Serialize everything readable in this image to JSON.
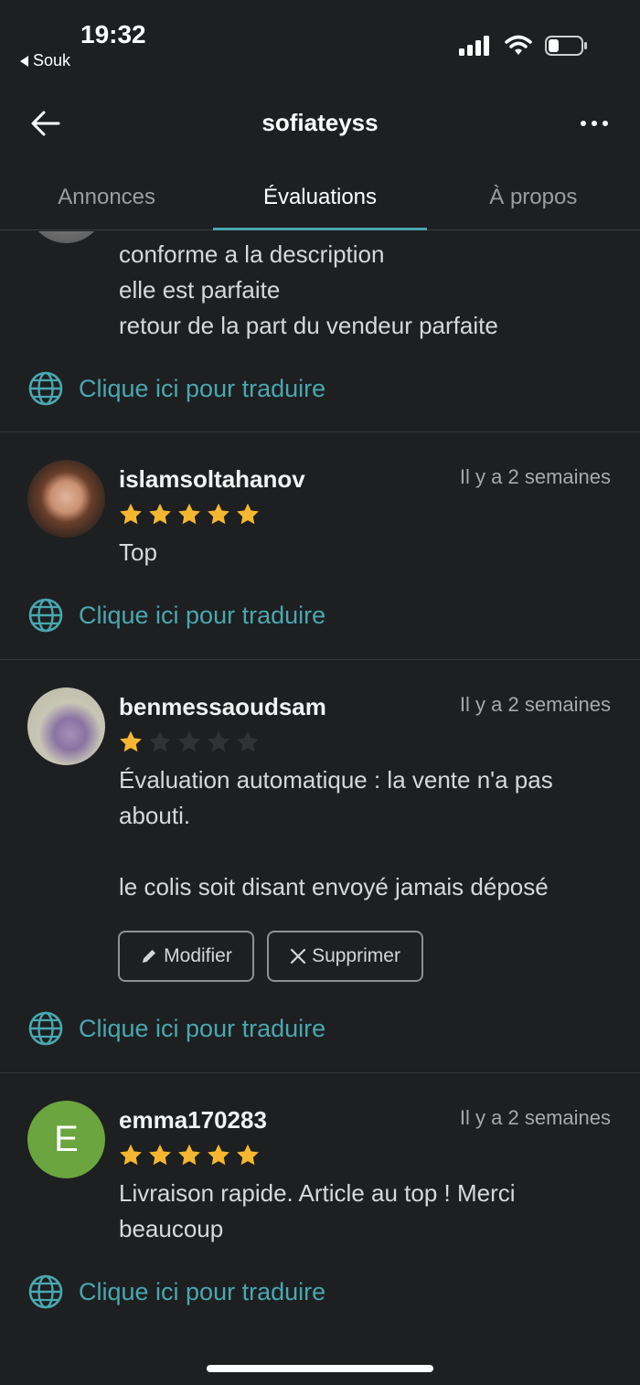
{
  "status_bar": {
    "time": "19:32",
    "back_app": "Souk",
    "icons": [
      "signal-icon",
      "wifi-icon",
      "battery-icon"
    ]
  },
  "header": {
    "title": "sofiateyss",
    "back_icon": "arrow-left-icon",
    "more_icon": "more-horizontal-icon"
  },
  "tabs": [
    {
      "label": "Annonces",
      "active": false
    },
    {
      "label": "Évaluations",
      "active": true
    },
    {
      "label": "À propos",
      "active": false
    }
  ],
  "colors": {
    "background": "#1d1f21",
    "accent": "#4aa7b0",
    "star_filled": "#f5b731",
    "star_empty": "#2f3336",
    "avatar_e": "#6aa53f"
  },
  "translate_label": "Clique ici pour traduire",
  "reviews": [
    {
      "username": "",
      "date": "",
      "rating": null,
      "lines": [
        "conforme a la description",
        "elle est parfaite",
        "retour de la part du vendeur parfaite"
      ]
    },
    {
      "username": "islamsoltahanov",
      "date": "Il y a 2 semaines",
      "rating": 5,
      "lines": [
        "Top"
      ]
    },
    {
      "username": "benmessaoudsam",
      "date": "Il y a 2 semaines",
      "rating": 1,
      "lines": [
        "Évaluation automatique : la vente n'a pas",
        "abouti.",
        "",
        "le colis soit disant envoyé jamais déposé"
      ],
      "actions": {
        "edit_label": "Modifier",
        "delete_label": "Supprimer"
      }
    },
    {
      "username": "emma170283",
      "date": "Il y a 2 semaines",
      "rating": 5,
      "avatar_letter": "E",
      "lines": [
        "Livraison rapide. Article au top ! Merci",
        "beaucoup"
      ]
    }
  ]
}
